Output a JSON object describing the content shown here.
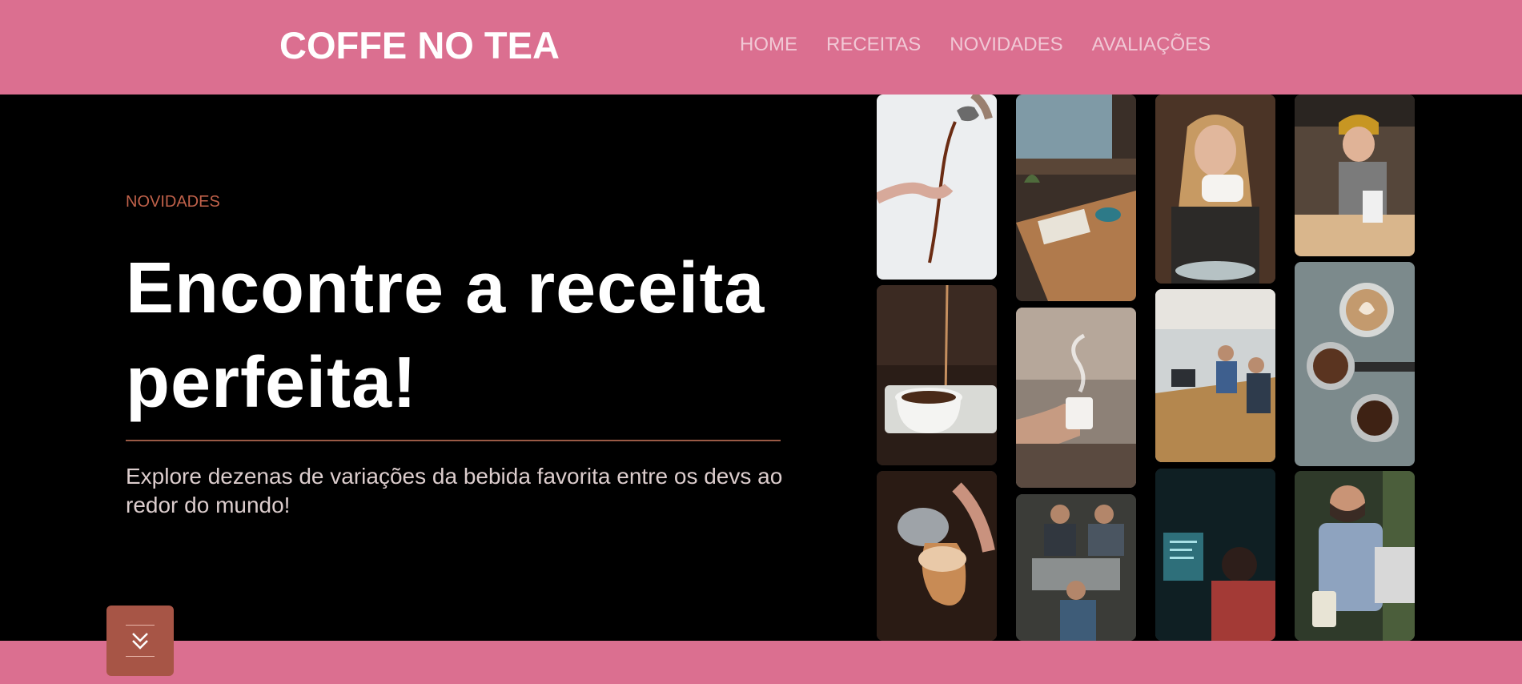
{
  "header": {
    "logo": "COFFE NO TEA",
    "nav": [
      {
        "label": "HOME"
      },
      {
        "label": "RECEITAS"
      },
      {
        "label": "NOVIDADES"
      },
      {
        "label": "AVALIAÇÕES"
      }
    ]
  },
  "hero": {
    "kicker": "NOVIDADES",
    "headline": "Encontre a receita perfeita!",
    "lead": "Explore dezenas de variações da bebida favorita entre os devs ao redor do mundo!"
  },
  "gallery": {
    "photos": [
      {
        "name": "photo-pouring-coffee"
      },
      {
        "name": "photo-cafe-window-table"
      },
      {
        "name": "photo-woman-drinking-coffee"
      },
      {
        "name": "photo-barista-espresso-machine"
      },
      {
        "name": "photo-coffee-stream-cup"
      },
      {
        "name": "photo-hand-holding-mug"
      },
      {
        "name": "photo-office-coworkers"
      },
      {
        "name": "photo-latte-art-beans"
      },
      {
        "name": "photo-latte-art-pour"
      },
      {
        "name": "photo-baristas-working"
      },
      {
        "name": "photo-developer-screens"
      },
      {
        "name": "photo-man-with-laptop"
      }
    ]
  },
  "scroll_button": {
    "icon": "double-chevron-down-icon"
  },
  "colors": {
    "brand_pink": "#db6f90",
    "accent_brown": "#a75546",
    "kicker": "#c0614a"
  }
}
